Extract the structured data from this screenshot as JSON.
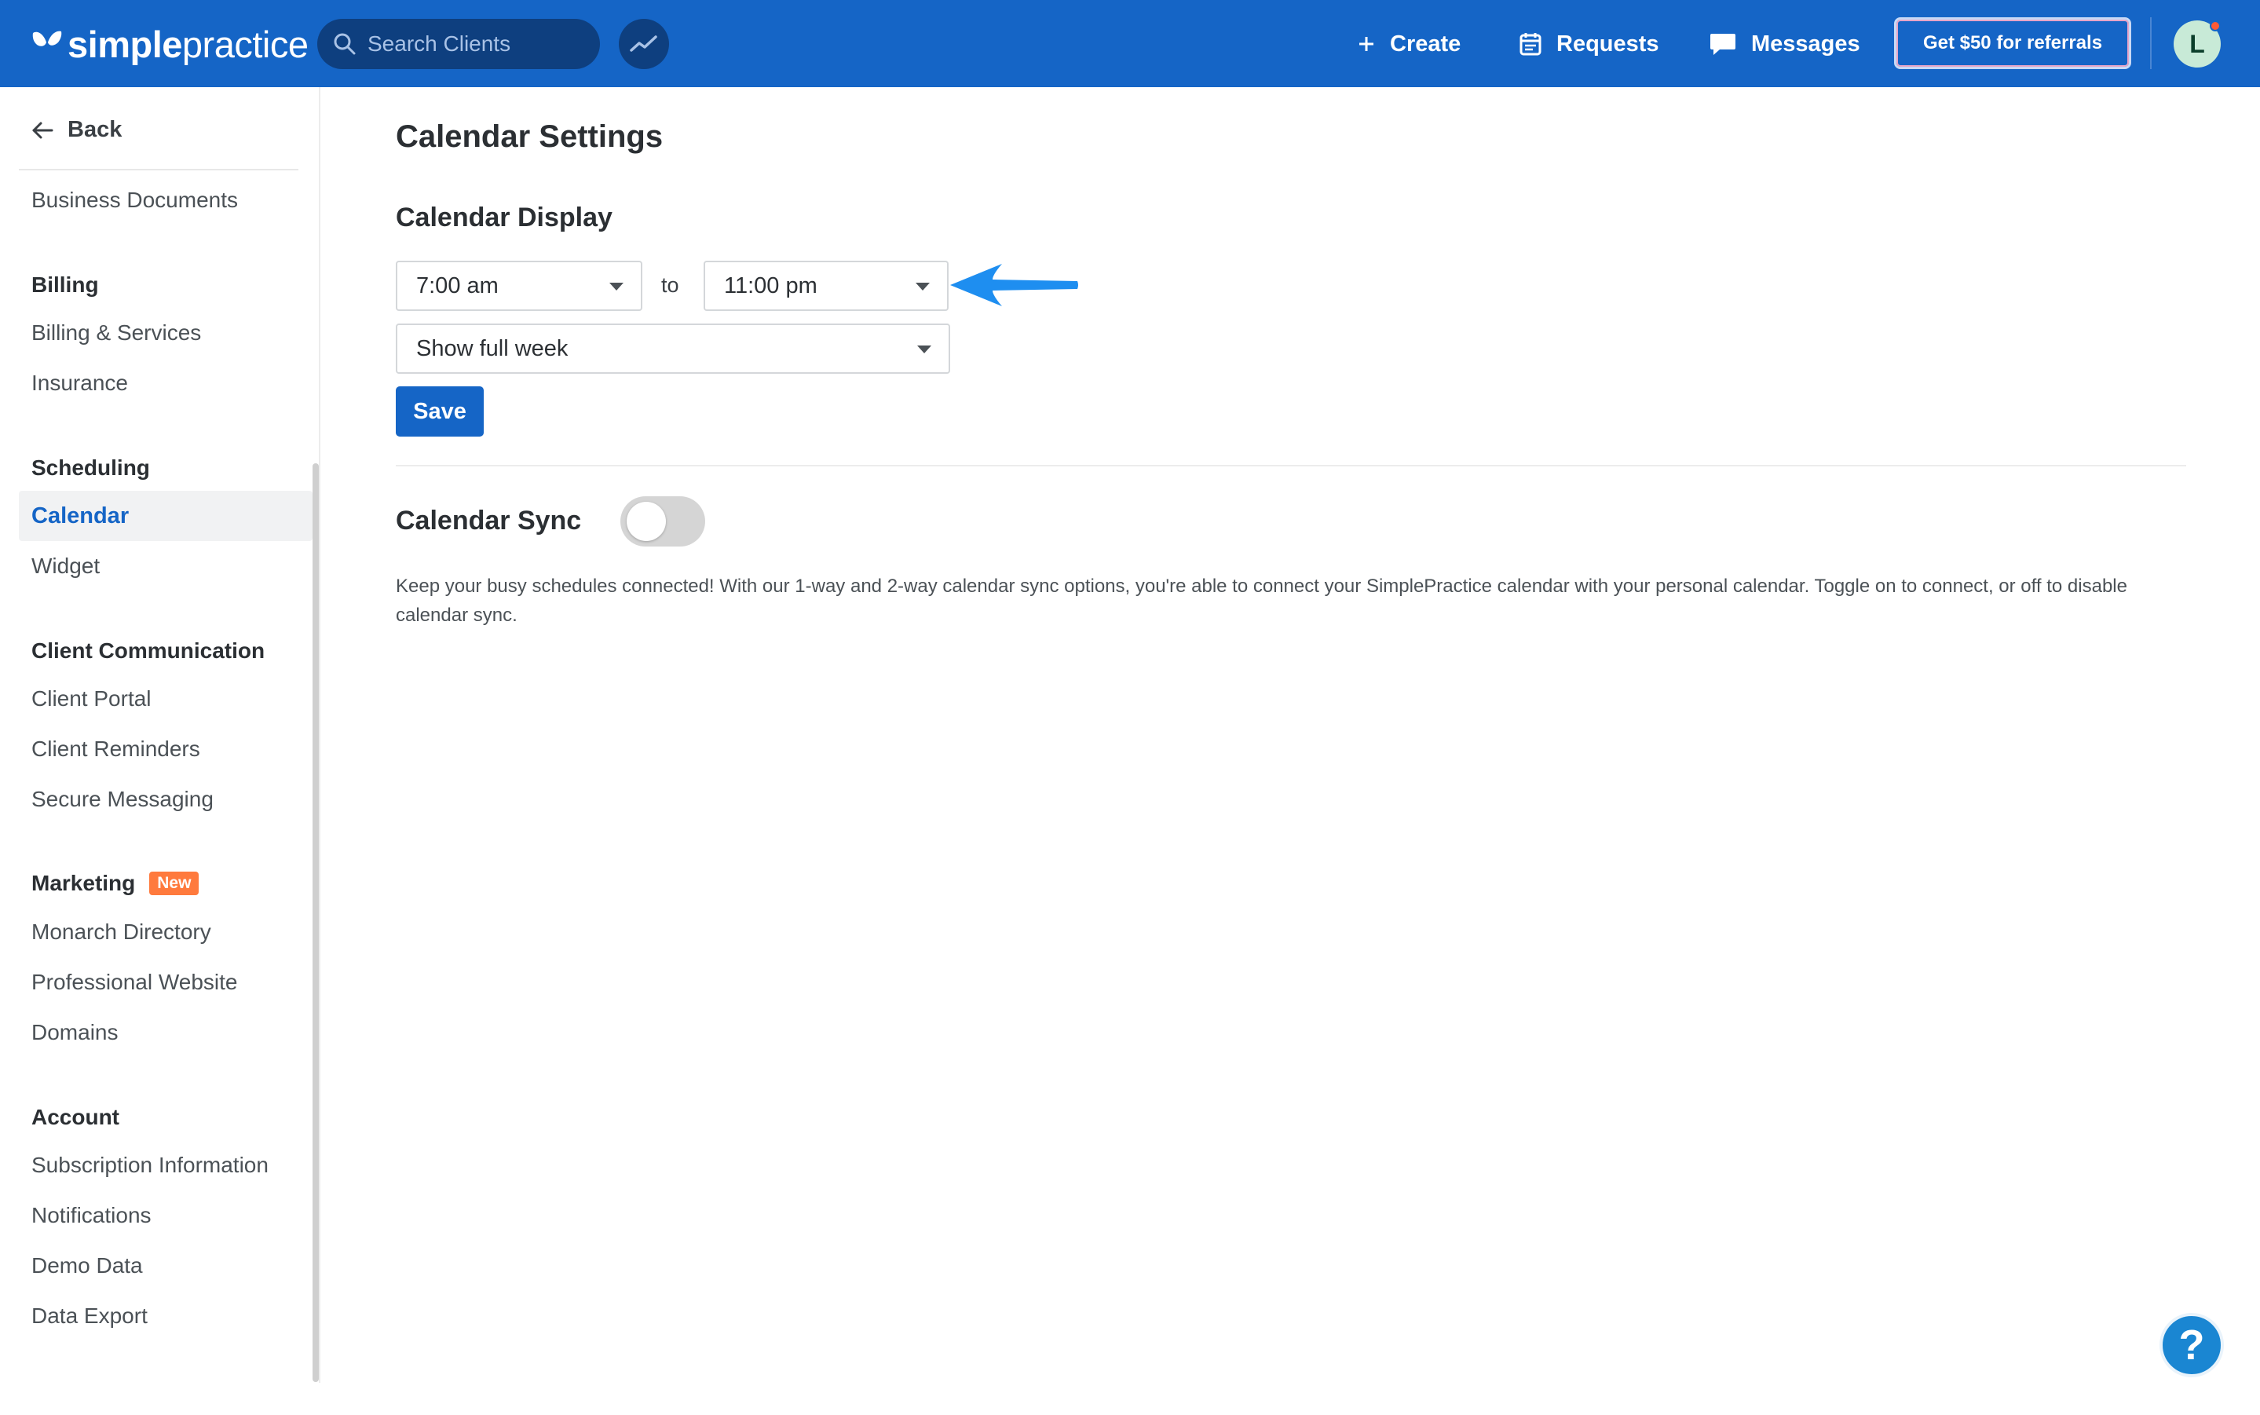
{
  "header": {
    "brand_bold": "simple",
    "brand_light": "practice",
    "search_placeholder": "Search Clients",
    "create_label": "Create",
    "requests_label": "Requests",
    "messages_label": "Messages",
    "referral_label": "Get $50 for referrals",
    "avatar_initial": "L"
  },
  "sidebar": {
    "back_label": "Back",
    "business_documents": "Business Documents",
    "billing_heading": "Billing",
    "billing_services": "Billing & Services",
    "insurance": "Insurance",
    "scheduling_heading": "Scheduling",
    "calendar": "Calendar",
    "widget": "Widget",
    "client_comm_heading": "Client Communication",
    "client_portal": "Client Portal",
    "client_reminders": "Client Reminders",
    "secure_messaging": "Secure Messaging",
    "marketing_heading": "Marketing",
    "new_badge": "New",
    "monarch_directory": "Monarch Directory",
    "professional_website": "Professional Website",
    "domains": "Domains",
    "account_heading": "Account",
    "subscription_information": "Subscription Information",
    "notifications": "Notifications",
    "demo_data": "Demo Data",
    "data_export": "Data Export"
  },
  "main": {
    "page_title": "Calendar Settings",
    "display_title": "Calendar Display",
    "start_time": "7:00 am",
    "to_label": "to",
    "end_time": "11:00 pm",
    "week_view": "Show full week",
    "save_label": "Save",
    "sync_title": "Calendar Sync",
    "sync_enabled": false,
    "sync_description": "Keep your busy schedules connected! With our 1-way and 2-way calendar sync options, you're able to connect your SimplePractice calendar with your personal calendar. Toggle on to connect, or off to disable calendar sync."
  },
  "help_label": "?",
  "colors": {
    "primary": "#1565c6",
    "arrow": "#1e8ef0",
    "new_badge": "#ff7a3d"
  }
}
